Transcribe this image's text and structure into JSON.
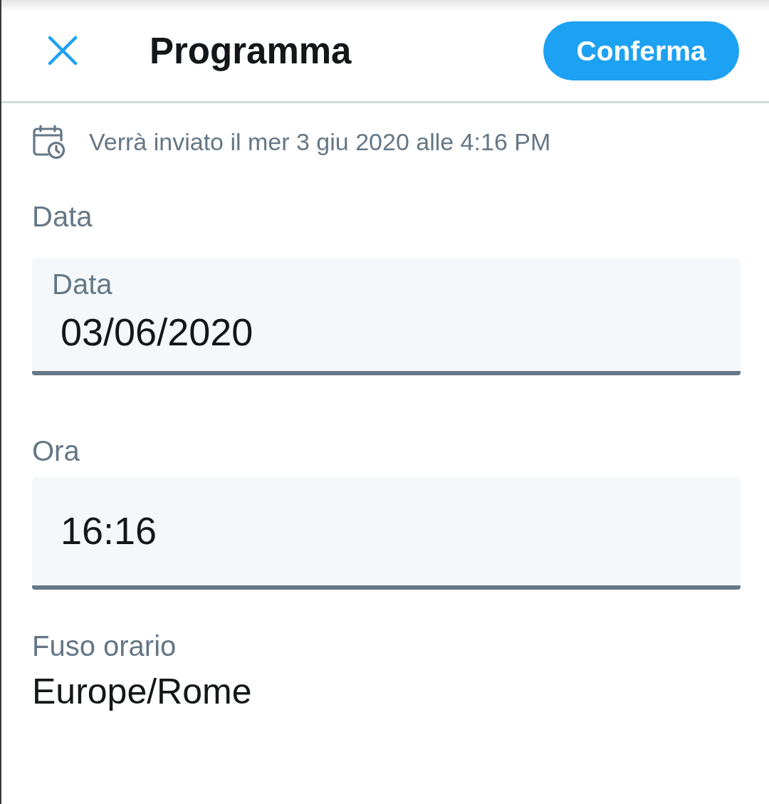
{
  "header": {
    "title": "Programma",
    "confirm_button": "Conferma"
  },
  "schedule_notice": "Verrà inviato il mer 3 giu 2020 alle 4:16 PM",
  "date": {
    "label": "Data",
    "field": {
      "label": "Data",
      "value": "03/06/2020"
    }
  },
  "time": {
    "label": "Ora",
    "field": {
      "value": "16:16"
    }
  },
  "timezone": {
    "label": "Fuso orario",
    "value": "Europe/Rome"
  }
}
